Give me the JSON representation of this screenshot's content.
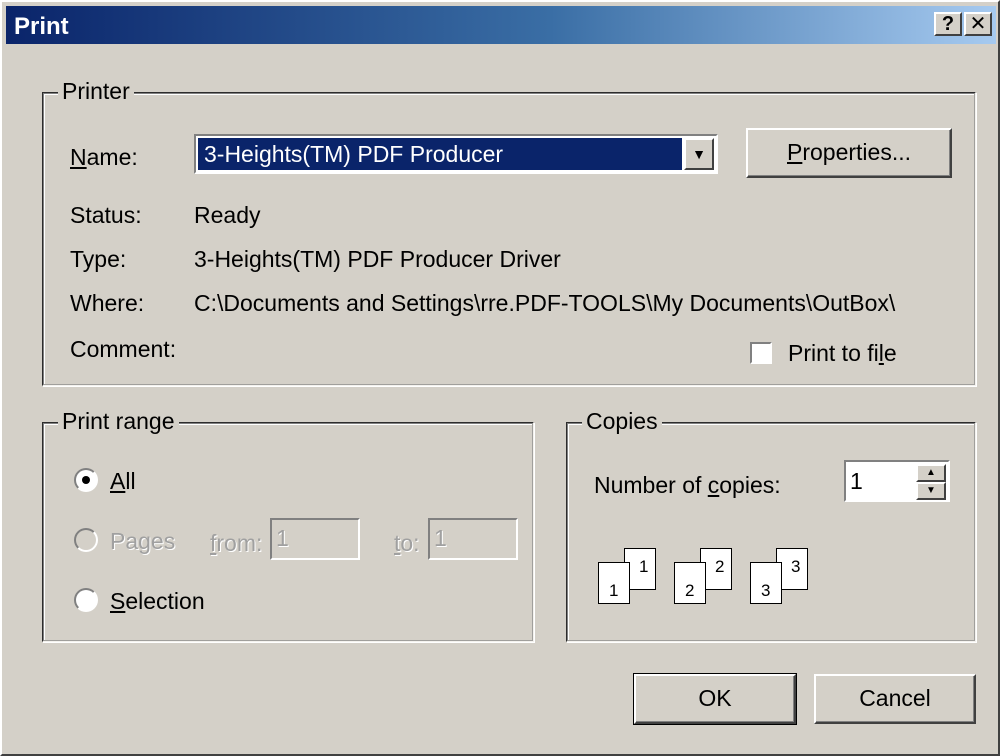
{
  "title": "Print",
  "titlebar_buttons": {
    "help": "?",
    "close": "✕"
  },
  "printer": {
    "group_label": "Printer",
    "name_label": "Name:",
    "name_value": "3-Heights(TM) PDF Producer",
    "properties_button": "Properties...",
    "status_label": "Status:",
    "status_value": "Ready",
    "type_label": "Type:",
    "type_value": "3-Heights(TM) PDF Producer Driver",
    "where_label": "Where:",
    "where_value": "C:\\Documents and Settings\\rre.PDF-TOOLS\\My Documents\\OutBox\\",
    "comment_label": "Comment:",
    "print_to_file_label": "Print to file",
    "print_to_file_checked": false
  },
  "print_range": {
    "group_label": "Print range",
    "all_label": "All",
    "pages_label": "Pages",
    "from_label": "from:",
    "from_value": "1",
    "to_label": "to:",
    "to_value": "1",
    "selection_label": "Selection",
    "selected": "All"
  },
  "copies": {
    "group_label": "Copies",
    "number_label": "Number of copies:",
    "number_value": "1",
    "collate_pages": [
      "1",
      "1",
      "2",
      "2",
      "3",
      "3"
    ]
  },
  "buttons": {
    "ok": "OK",
    "cancel": "Cancel"
  }
}
